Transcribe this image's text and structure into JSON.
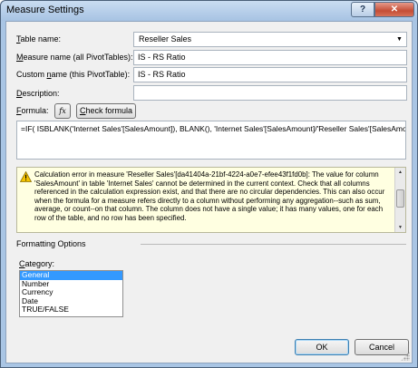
{
  "window": {
    "title": "Measure Settings",
    "help_glyph": "?",
    "close_glyph": "✕"
  },
  "form": {
    "table_name_label": "Table name:",
    "table_name_mnemonic": "T",
    "table_name_rest": "able name:",
    "table_name_value": "Reseller Sales",
    "measure_name_label_mnemonic": "M",
    "measure_name_label_rest": "easure name (all PivotTables):",
    "measure_name_value": "IS - RS Ratio",
    "custom_name_label_pre": "Custom ",
    "custom_name_label_mnemonic": "n",
    "custom_name_label_rest": "ame (this PivotTable):",
    "custom_name_value": "IS - RS Ratio",
    "description_label_mnemonic": "D",
    "description_label_rest": "escription:",
    "description_value": "",
    "formula_label_mnemonic": "F",
    "formula_label_rest": "ormula:",
    "fx_label": "fx",
    "check_formula_label_mnemonic": "C",
    "check_formula_label_rest": "heck formula",
    "formula_value": "=IF( ISBLANK('Internet Sales'[SalesAmount]), BLANK(), 'Internet Sales'[SalesAmount]/'Reseller Sales'[SalesAmount])"
  },
  "error": {
    "icon": "warning-icon",
    "message": "Calculation error in measure 'Reseller Sales'[da41404a-21bf-4224-a0e7-efee43f1fd0b]: The value for column 'SalesAmount' in table 'Internet Sales' cannot be determined in the current context. Check that all columns referenced in the calculation expression exist, and that there are no circular dependencies. This can also occur when the formula for a measure refers directly to a column without performing any aggregation--such as sum, average, or count--on that column. The column does not have a single value; it has many values, one for each row of the table, and no row has been specified."
  },
  "formatting": {
    "group_label": "Formatting Options",
    "category_label_mnemonic": "C",
    "category_label_rest": "ategory:",
    "categories": [
      "General",
      "Number",
      "Currency",
      "Date",
      "TRUE/FALSE"
    ],
    "selected_index": 0
  },
  "buttons": {
    "ok": "OK",
    "cancel": "Cancel"
  },
  "colors": {
    "selection": "#3399ff",
    "error_background": "#ffffe1",
    "titlebar": "#a9c5e4",
    "close_button": "#c44d35"
  }
}
